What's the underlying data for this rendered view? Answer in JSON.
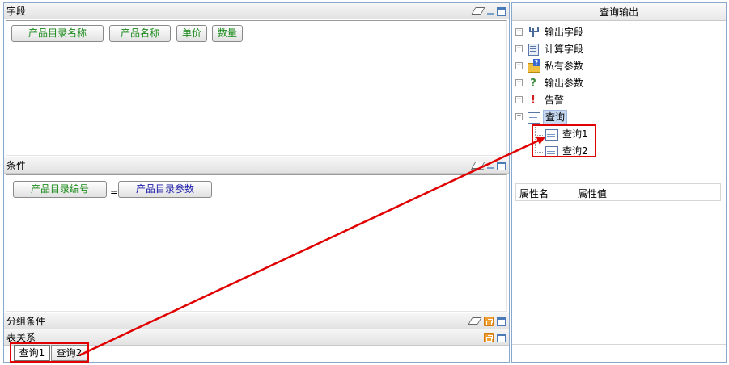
{
  "fields_panel": {
    "title": "字段",
    "chips": [
      "产品目录名称",
      "产品名称",
      "单价",
      "数量"
    ]
  },
  "condition_panel": {
    "title": "条件",
    "left_operand": "产品目录编号",
    "operator": "=",
    "right_operand": "产品目录参数"
  },
  "group_panel": {
    "title": "分组条件"
  },
  "relation_panel": {
    "title": "表关系",
    "tabs": [
      "查询1",
      "查询2"
    ]
  },
  "query_output": {
    "title": "查询输出",
    "tree": [
      {
        "label": "输出字段",
        "icon": "fork-icon"
      },
      {
        "label": "计算字段",
        "icon": "calculator-icon"
      },
      {
        "label": "私有参数",
        "icon": "folder-question-icon"
      },
      {
        "label": "输出参数",
        "icon": "question-icon"
      },
      {
        "label": "告警",
        "icon": "exclamation-icon"
      },
      {
        "label": "查询",
        "icon": "query-table-icon"
      }
    ],
    "children": [
      "查询1",
      "查询2"
    ]
  },
  "properties": {
    "col_name": "属性名",
    "col_value": "属性值"
  },
  "colors": {
    "annotation": "#e00000",
    "field_text": "#1a8a1a",
    "param_text": "#1a1aa8",
    "border": "#8aa8cc"
  }
}
